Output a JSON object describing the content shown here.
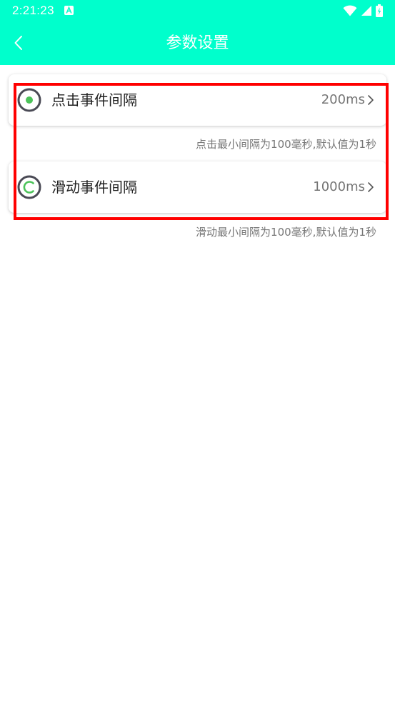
{
  "status_bar": {
    "time": "2:21:23",
    "icons": [
      "notification-a-icon",
      "wifi-icon",
      "signal-icon",
      "battery-icon"
    ]
  },
  "header": {
    "title": "参数设置",
    "back_icon": "chevron-left-icon",
    "background_color": "#00FFCC"
  },
  "settings": [
    {
      "label": "点击事件间隔",
      "value": "200ms",
      "icon": "tap-target-icon",
      "hint": "点击最小间隔为100毫秒,默认值为1秒"
    },
    {
      "label": "滑动事件间隔",
      "value": "1000ms",
      "icon": "swipe-circle-icon",
      "hint": "滑动最小间隔为100毫秒,默认值为1秒"
    }
  ],
  "colors": {
    "accent": "#00FFCC",
    "icon_green": "#4CC35A",
    "icon_ring": "#4A4A55",
    "highlight": "#FF0000"
  }
}
